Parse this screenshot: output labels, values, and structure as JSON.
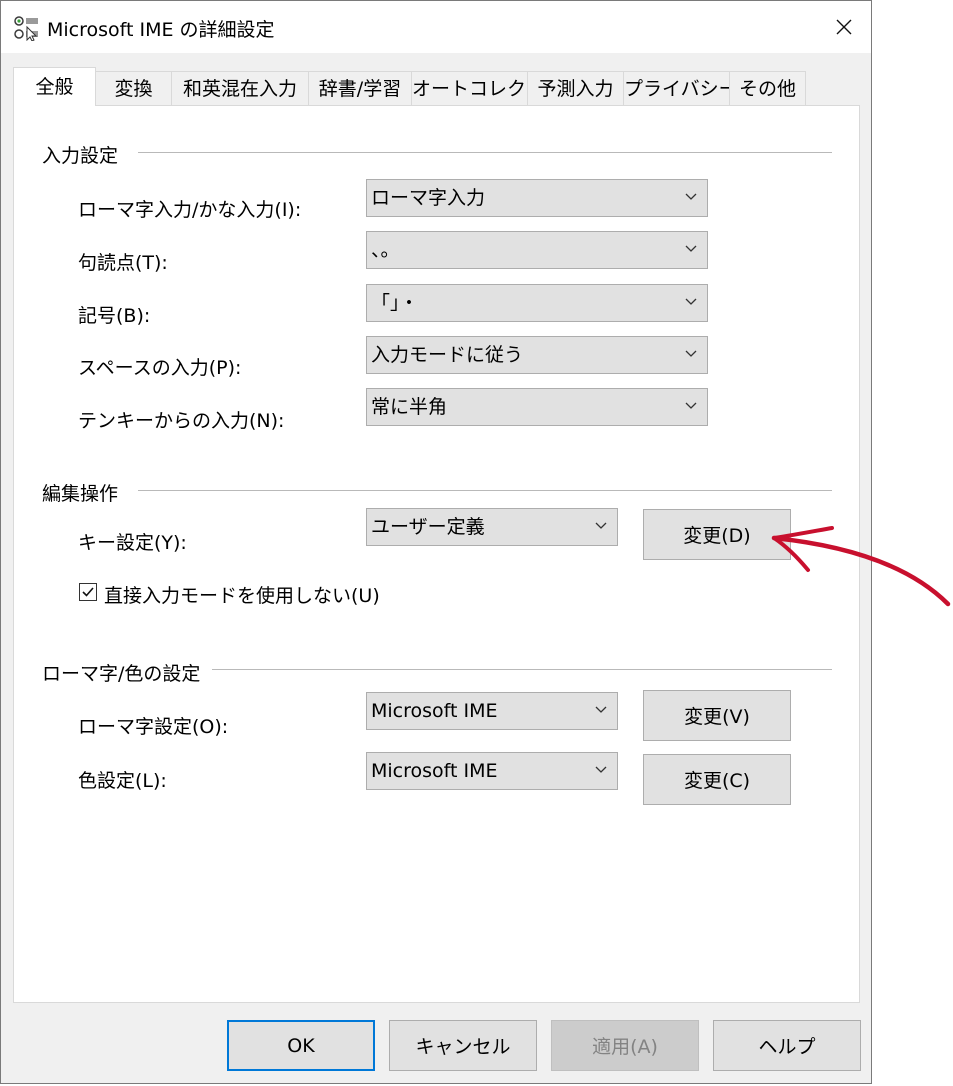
{
  "window": {
    "title": "Microsoft IME の詳細設定"
  },
  "tabs": [
    {
      "label": "全般",
      "active": true
    },
    {
      "label": "変換"
    },
    {
      "label": "和英混在入力"
    },
    {
      "label": "辞書/学習"
    },
    {
      "label": "オートコレクト"
    },
    {
      "label": "予測入力"
    },
    {
      "label": "プライバシー"
    },
    {
      "label": "その他"
    }
  ],
  "input_settings": {
    "title": "入力設定",
    "rows": [
      {
        "label": "ローマ字入力/かな入力(I):",
        "value": "ローマ字入力"
      },
      {
        "label": "句読点(T):",
        "value": "、。"
      },
      {
        "label": "記号(B):",
        "value": "「」・"
      },
      {
        "label": "スペースの入力(P):",
        "value": "入力モードに従う"
      },
      {
        "label": "テンキーからの入力(N):",
        "value": "常に半角"
      }
    ]
  },
  "editing": {
    "title": "編集操作",
    "key_label": "キー設定(Y):",
    "key_value": "ユーザー定義",
    "key_button": "変更(D)",
    "checkbox_label": "直接入力モードを使用しない(U)",
    "checkbox_checked": true
  },
  "romaji_color": {
    "title": "ローマ字/色の設定",
    "romaji_label": "ローマ字設定(O):",
    "romaji_value": "Microsoft IME",
    "romaji_button": "変更(V)",
    "color_label": "色設定(L):",
    "color_value": "Microsoft IME",
    "color_button": "変更(C)"
  },
  "footer": {
    "ok": "OK",
    "cancel": "キャンセル",
    "apply": "適用(A)",
    "help": "ヘルプ"
  },
  "colors": {
    "accent": "#0078d7",
    "annotation_arrow": "#c8102e"
  }
}
